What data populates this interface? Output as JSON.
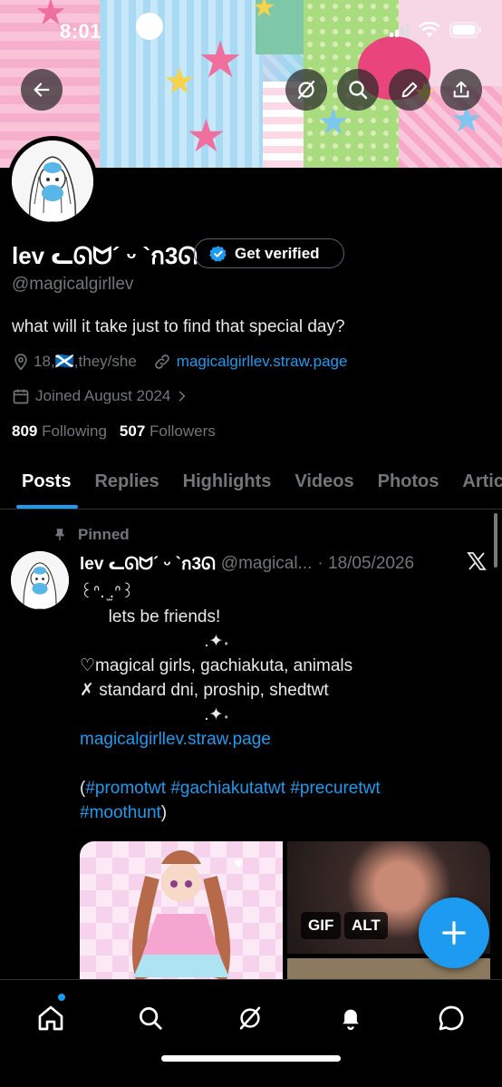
{
  "status_bar": {
    "time": "8:01"
  },
  "header_actions": {
    "back": "back-arrow-icon",
    "grok": "grok-icon",
    "search": "search-icon",
    "edit": "edit-icon",
    "share": "share-icon"
  },
  "profile": {
    "display_name": "lev ᓚᘏᗢ´ ᵕ `ก3ᘏ",
    "verify_label": "Get verified",
    "handle": "@magicalgirllev",
    "bio": "what will it take just to find that special day?",
    "location": "18,🏴󠁧󠁢󠁳󠁣󠁴󠁿,they/she",
    "website": "magicalgirllev.straw.page",
    "joined": "Joined August 2024",
    "following_count": "809",
    "following_label": "Following",
    "followers_count": "507",
    "followers_label": "Followers"
  },
  "tabs": [
    {
      "label": "Posts",
      "active": true
    },
    {
      "label": "Replies"
    },
    {
      "label": "Highlights"
    },
    {
      "label": "Videos"
    },
    {
      "label": "Photos"
    },
    {
      "label": "Articles"
    }
  ],
  "post": {
    "pinned_label": "Pinned",
    "author_name": "lev ᓚᘏᗢ´ ᵕ `ก3ᘏ",
    "author_handle": "@magical...",
    "date": "· 18/05/2026",
    "line1": "꒰ᐢ. ̫.ᐢ꒱",
    "line2": "      lets be friends!",
    "line3": "                          .✦˖",
    "line4": "♡magical girls, gachiakuta, animals",
    "line5": "✗ standard dni, proship, shedtwt",
    "line6": "                          .✦˖",
    "link": "magicalgirllev.straw.page",
    "hashtags_open": "(",
    "hashtag1": "#promotwt",
    "hashtag2": "#gachiakutatwt",
    "hashtag3": "#precuretwt",
    "hashtag4": "#moothunt",
    "hashtags_close": ")",
    "gif_badge": "GIF",
    "alt_badge": "ALT"
  },
  "bottom_nav": [
    "home-icon",
    "search-icon",
    "grok-icon",
    "notifications-icon",
    "messages-icon"
  ],
  "colors": {
    "accent": "#1d9bf0",
    "background": "#000000",
    "muted": "#71767b"
  }
}
